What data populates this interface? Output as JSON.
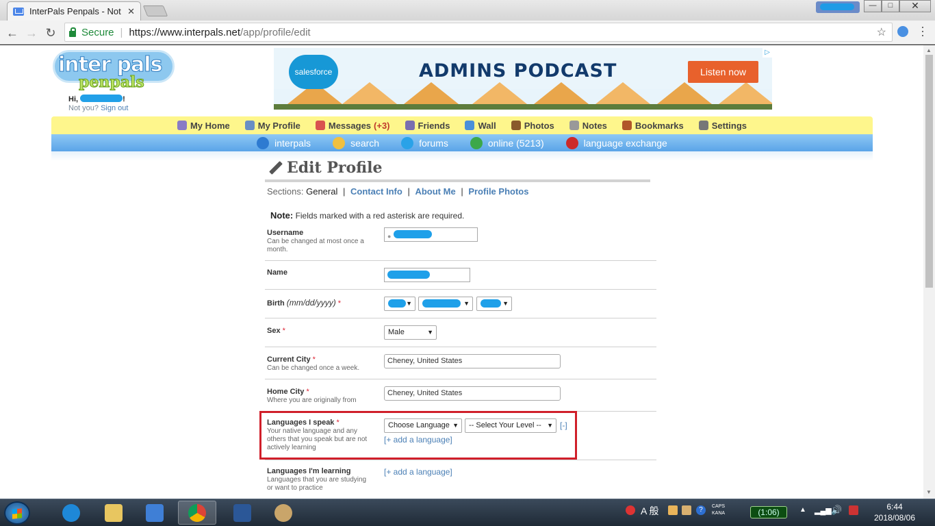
{
  "browser": {
    "tab_title": "InterPals Penpals - Not",
    "tab_close": "✕",
    "url_secure": "Secure",
    "url_host": "https://www.interpals.net",
    "url_path": "/app/profile/edit",
    "window_controls": {
      "minimize": "—",
      "maximize": "□",
      "close": "✕"
    }
  },
  "site": {
    "logo_word1": "inter",
    "logo_word2": "pals",
    "logo_word3": "penpals",
    "greeting": "Hi,",
    "greeting_end": "!",
    "not_you": "Not you?",
    "sign_out": "Sign out"
  },
  "ad": {
    "brand": "salesforce",
    "headline": "ADMINS PODCAST",
    "cta": "Listen now",
    "ad_choices": "▷"
  },
  "main_nav": [
    {
      "label": "My Home",
      "icon": "home-icon",
      "color": "#8a7cc5"
    },
    {
      "label": "My Profile",
      "icon": "profile-icon",
      "color": "#6a8fc4"
    },
    {
      "label": "Messages",
      "badge": "(+3)",
      "icon": "envelope-icon",
      "color": "#d9534f"
    },
    {
      "label": "Friends",
      "icon": "friends-icon",
      "color": "#7a6fb0"
    },
    {
      "label": "Wall",
      "icon": "wall-icon",
      "color": "#4a90d9"
    },
    {
      "label": "Photos",
      "icon": "photos-icon",
      "color": "#8a5a2b"
    },
    {
      "label": "Notes",
      "icon": "notes-icon",
      "color": "#999999"
    },
    {
      "label": "Bookmarks",
      "icon": "bookmark-icon",
      "color": "#b0562a"
    },
    {
      "label": "Settings",
      "icon": "settings-icon",
      "color": "#777777"
    }
  ],
  "sub_nav": [
    {
      "label": "interpals",
      "icon": "globe-icon",
      "color": "#2e7bd1"
    },
    {
      "label": "search",
      "icon": "magnifier-icon",
      "color": "#f0c040"
    },
    {
      "label": "forums",
      "icon": "chat-bubble-icon",
      "color": "#2aa2e8"
    },
    {
      "label": "online (5213)",
      "icon": "online-user-icon",
      "color": "#3ca84a"
    },
    {
      "label": "language exchange",
      "icon": "flags-icon",
      "color": "#cc2a2a"
    }
  ],
  "page": {
    "title": "Edit Profile",
    "sections_label": "Sections:",
    "sections_current": "General",
    "sections_links": [
      "Contact Info",
      "About Me",
      "Profile Photos"
    ],
    "separator": "|",
    "note_bold": "Note:",
    "note_text": "Fields marked with a red asterisk are required."
  },
  "form": {
    "username": {
      "label": "Username",
      "hint": "Can be changed at most once a month."
    },
    "name": {
      "label": "Name"
    },
    "birth": {
      "label": "Birth",
      "format": "(mm/dd/yyyy)",
      "required": "*"
    },
    "sex": {
      "label": "Sex",
      "required": "*",
      "value": "Male"
    },
    "current_city": {
      "label": "Current City",
      "required": "*",
      "hint": "Can be changed once a week.",
      "value": "Cheney, United States"
    },
    "home_city": {
      "label": "Home City",
      "required": "*",
      "hint": "Where you are originally from",
      "value": "Cheney, United States"
    },
    "languages_speak": {
      "label": "Languages I speak",
      "required": "*",
      "hint": "Your native language and any others that you speak but are not actively learning",
      "language_value": "Choose Language",
      "level_value": "-- Select Your Level --",
      "remove": "[-]",
      "add": "[+ add a language]"
    },
    "languages_learning": {
      "label": "Languages I'm learning",
      "hint": "Languages that you are studying or want to practice",
      "add": "[+ add a language]"
    }
  },
  "taskbar": {
    "battery": "(1:06)",
    "ime_label": "A 般",
    "caps": "CAPS",
    "kana": "KANA",
    "time": "6:44",
    "date": "2018/08/06"
  },
  "dropdown_arrow": "▼"
}
